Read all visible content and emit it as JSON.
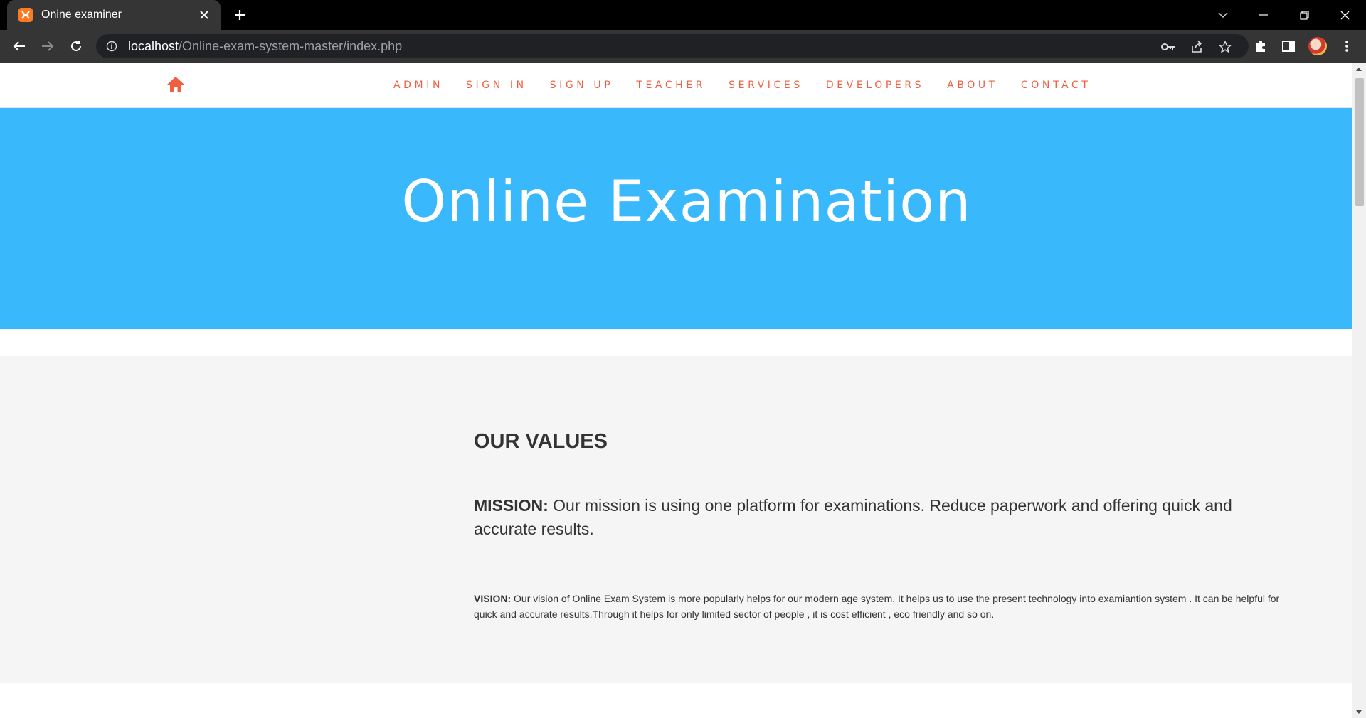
{
  "browser": {
    "tab_title": "Onine examiner",
    "url_host": "localhost",
    "url_path": "/Online-exam-system-master/index.php",
    "theme_colors": {
      "tabbar": "#000000",
      "toolbar": "#353535",
      "omnibox": "#202124"
    }
  },
  "site": {
    "brand_color": "#f05f40",
    "hero_color": "#3ab8fc",
    "nav": {
      "home_icon": "home-icon",
      "items": [
        {
          "label": "ADMIN"
        },
        {
          "label": "SIGN IN"
        },
        {
          "label": "SIGN UP"
        },
        {
          "label": "TEACHER"
        },
        {
          "label": "SERVICES"
        },
        {
          "label": "DEVELOPERS"
        },
        {
          "label": "ABOUT"
        },
        {
          "label": "CONTACT"
        }
      ]
    },
    "hero": {
      "title": "Online Examination"
    },
    "values": {
      "heading": "OUR VALUES",
      "mission_label": "MISSION:",
      "mission_text": " Our mission is using one platform for examinations. Reduce paperwork and offering quick and accurate results.",
      "vision_label": "VISION:",
      "vision_text": " Our vision of Online Exam System is more popularly helps for our modern age system. It helps us to use the present technology into examiantion system . It can be helpful for quick and accurate results.Through it helps for only limited sector of people , it is cost efficient , eco friendly and so on."
    }
  }
}
